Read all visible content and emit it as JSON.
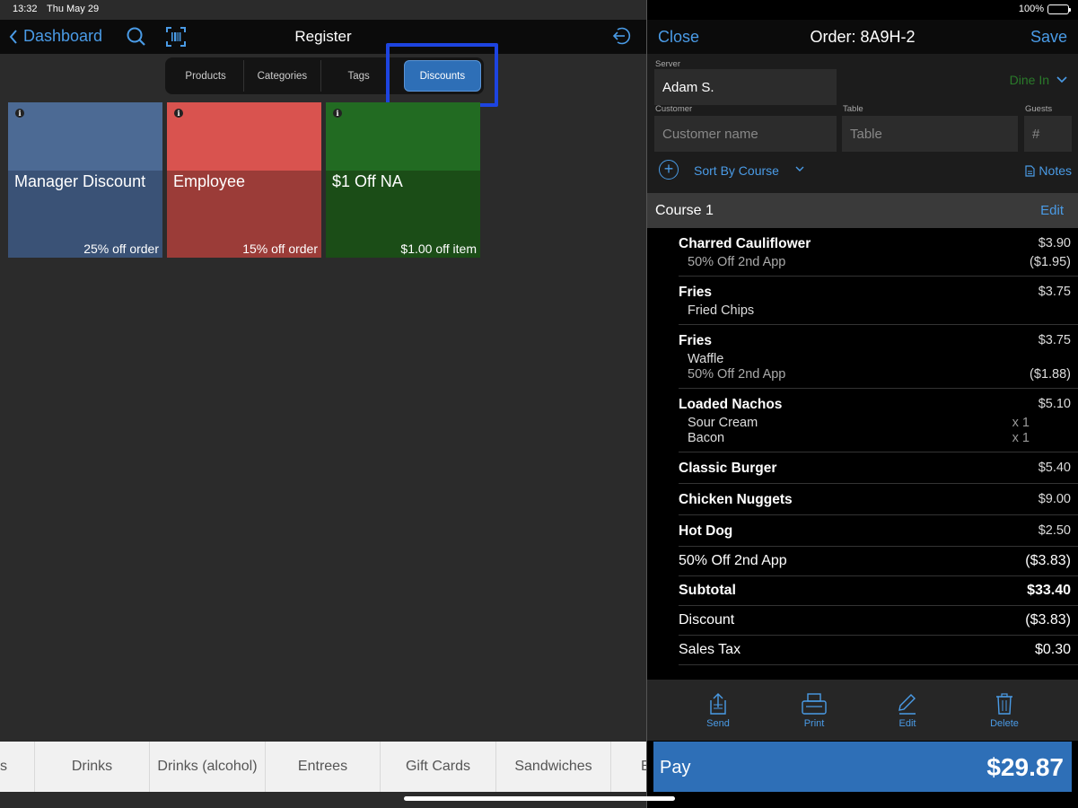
{
  "status": {
    "time": "13:32",
    "date": "Thu May 29",
    "battery": "100%"
  },
  "left": {
    "back_label": "Dashboard",
    "title": "Register",
    "segments": [
      "Products",
      "Categories",
      "Tags",
      "Discounts"
    ],
    "active_segment": "Discounts",
    "tiles": [
      {
        "name": "Manager Discount",
        "sub": "25% off order",
        "top_color": "#4c6a94",
        "bottom_color": "#3a5276"
      },
      {
        "name": "Employee",
        "sub": "15% off order",
        "top_color": "#d9534f",
        "bottom_color": "#9b3c38"
      },
      {
        "name": "$1 Off NA",
        "sub": "$1.00 off item",
        "top_color": "#226b22",
        "bottom_color": "#1b4d17"
      }
    ],
    "categories": [
      "s",
      "Drinks",
      "Drinks (alcohol)",
      "Entrees",
      "Gift Cards",
      "Sandwiches",
      "E"
    ]
  },
  "right": {
    "close_label": "Close",
    "order_title": "Order: 8A9H-2",
    "save_label": "Save",
    "server_label": "Server",
    "server_value": "Adam S.",
    "dine_label": "Dine In",
    "customer_label": "Customer",
    "customer_placeholder": "Customer name",
    "table_label": "Table",
    "table_placeholder": "Table",
    "guests_label": "Guests",
    "guests_placeholder": "#",
    "sort_label": "Sort By Course",
    "notes_label": "Notes",
    "course_label": "Course 1",
    "course_edit": "Edit",
    "items": [
      {
        "name": "Charred Cauliflower",
        "price": "$3.90",
        "mods": [
          {
            "text": "50% Off 2nd App",
            "value": "($1.95)",
            "discount": true
          }
        ]
      },
      {
        "name": "Fries",
        "price": "$3.75",
        "mods": [
          {
            "text": "Fried Chips",
            "value": "",
            "discount": false
          }
        ]
      },
      {
        "name": "Fries",
        "price": "$3.75",
        "mods": [
          {
            "text": "Waffle",
            "value": "",
            "discount": false
          },
          {
            "text": "50% Off 2nd App",
            "value": "($1.88)",
            "discount": true
          }
        ]
      },
      {
        "name": "Loaded Nachos",
        "price": "$5.10",
        "mods": [
          {
            "text": "Sour Cream",
            "qty": "x 1"
          },
          {
            "text": "Bacon",
            "qty": "x 1"
          }
        ]
      },
      {
        "name": "Classic Burger",
        "price": "$5.40",
        "mods": []
      },
      {
        "name": "Chicken Nuggets",
        "price": "$9.00",
        "mods": []
      },
      {
        "name": "Hot Dog",
        "price": "$2.50",
        "mods": []
      }
    ],
    "totals": [
      {
        "label": "50% Off 2nd App",
        "value": "($3.83)",
        "bold": false
      },
      {
        "label": "Subtotal",
        "value": "$33.40",
        "bold": true
      },
      {
        "label": "Discount",
        "value": "($3.83)",
        "bold": false
      },
      {
        "label": "Sales Tax",
        "value": "$0.30",
        "bold": false
      }
    ],
    "actions": [
      "Send",
      "Print",
      "Edit",
      "Delete"
    ],
    "pay_label": "Pay",
    "pay_amount": "$29.87"
  }
}
